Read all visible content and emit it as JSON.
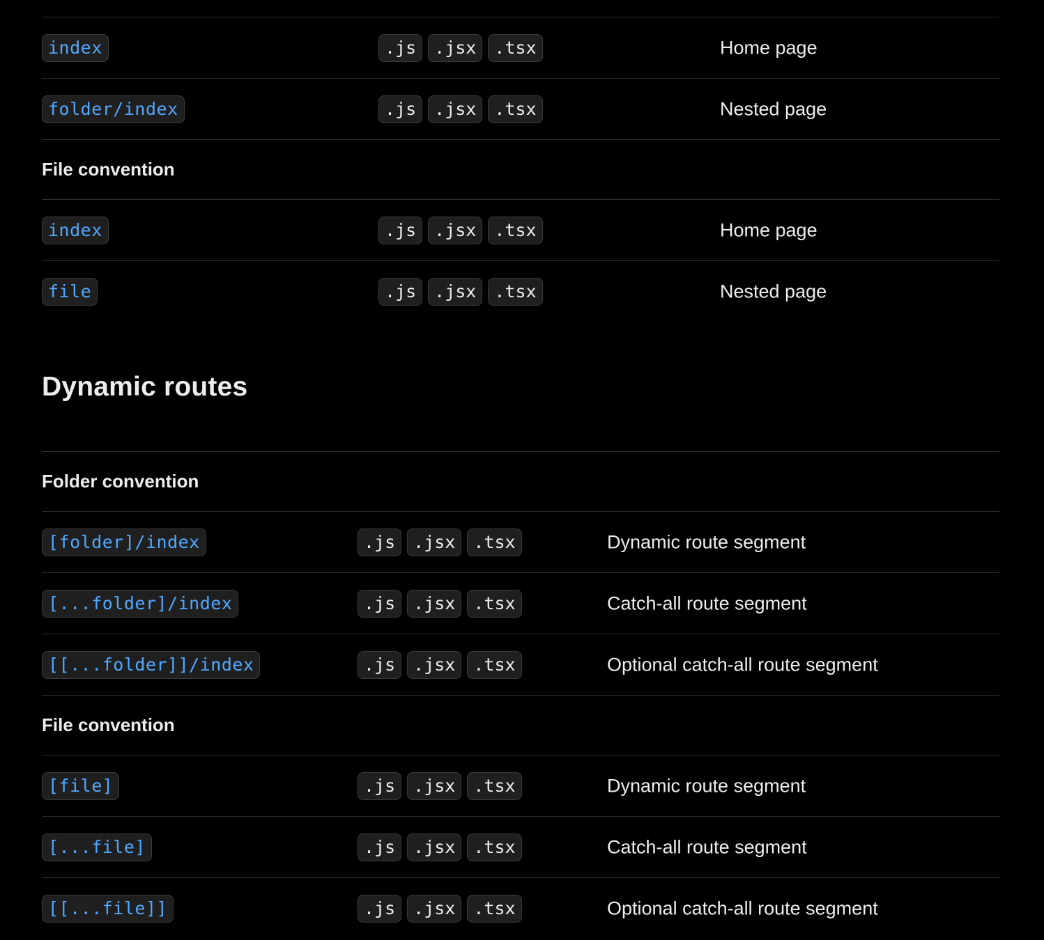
{
  "colors": {
    "background": "#000000",
    "text": "#ededed",
    "code_link": "#52a8ff",
    "chip_bg": "#1f1f1f",
    "chip_border": "#3a3a3a",
    "divider": "#2e2e2e"
  },
  "top_table": {
    "rows": [
      {
        "kind": "data",
        "name": "index",
        "exts": [
          ".js",
          ".jsx",
          ".tsx"
        ],
        "description": "Home page"
      },
      {
        "kind": "data",
        "name": "folder/index",
        "exts": [
          ".js",
          ".jsx",
          ".tsx"
        ],
        "description": "Nested page"
      },
      {
        "kind": "section",
        "label": "File convention"
      },
      {
        "kind": "data",
        "name": "index",
        "exts": [
          ".js",
          ".jsx",
          ".tsx"
        ],
        "description": "Home page"
      },
      {
        "kind": "data",
        "name": "file",
        "exts": [
          ".js",
          ".jsx",
          ".tsx"
        ],
        "description": "Nested page"
      }
    ]
  },
  "dynamic_routes": {
    "heading": "Dynamic routes",
    "rows": [
      {
        "kind": "section",
        "label": "Folder convention"
      },
      {
        "kind": "data",
        "name": "[folder]/index",
        "exts": [
          ".js",
          ".jsx",
          ".tsx"
        ],
        "description": "Dynamic route segment"
      },
      {
        "kind": "data",
        "name": "[...folder]/index",
        "exts": [
          ".js",
          ".jsx",
          ".tsx"
        ],
        "description": "Catch-all route segment"
      },
      {
        "kind": "data",
        "name": "[[...folder]]/index",
        "exts": [
          ".js",
          ".jsx",
          ".tsx"
        ],
        "description": "Optional catch-all route segment"
      },
      {
        "kind": "section",
        "label": "File convention"
      },
      {
        "kind": "data",
        "name": "[file]",
        "exts": [
          ".js",
          ".jsx",
          ".tsx"
        ],
        "description": "Dynamic route segment"
      },
      {
        "kind": "data",
        "name": "[...file]",
        "exts": [
          ".js",
          ".jsx",
          ".tsx"
        ],
        "description": "Catch-all route segment"
      },
      {
        "kind": "data",
        "name": "[[...file]]",
        "exts": [
          ".js",
          ".jsx",
          ".tsx"
        ],
        "description": "Optional catch-all route segment"
      }
    ]
  }
}
